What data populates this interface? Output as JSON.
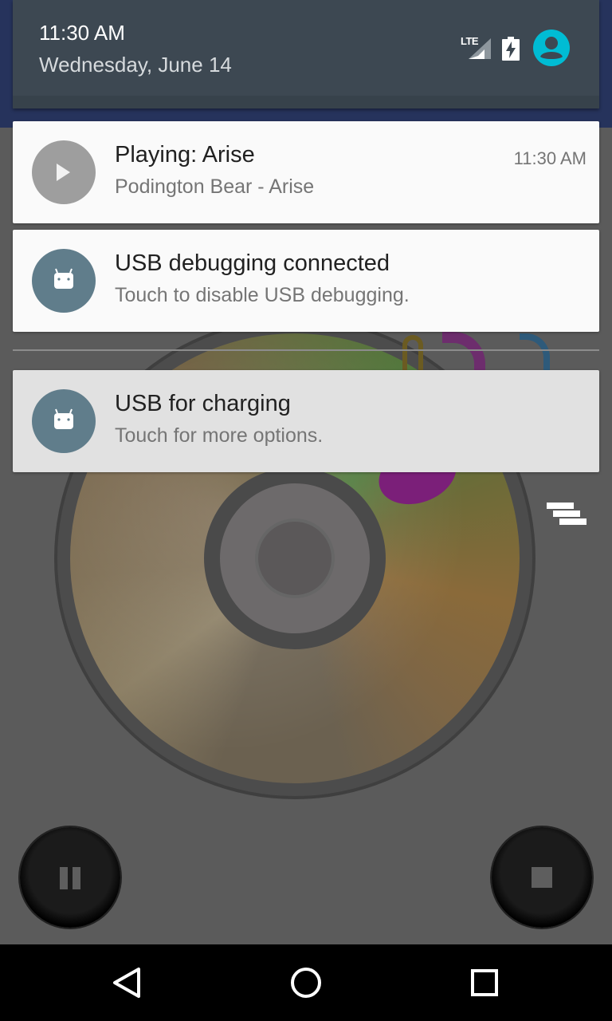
{
  "status": {
    "time": "11:30 AM",
    "date": "Wednesday, June 14",
    "network_label": "LTE",
    "icons": [
      "lte-signal-icon",
      "battery-charging-icon",
      "user-account-icon"
    ]
  },
  "notifications": [
    {
      "title": "Playing: Arise",
      "subtitle": "Podington Bear - Arise",
      "time": "11:30 AM",
      "icon": "play-icon",
      "icon_color": "#9e9e9e"
    },
    {
      "title": "USB debugging connected",
      "subtitle": "Touch to disable USB debugging.",
      "icon": "android-icon",
      "icon_color": "#607d8b"
    },
    {
      "title": "USB for charging",
      "subtitle": "Touch for more options.",
      "icon": "android-icon",
      "icon_color": "#607d8b"
    }
  ],
  "background_app": {
    "controls": [
      "pause-icon",
      "stop-icon",
      "overflow-menu-icon"
    ]
  },
  "navigation": [
    "back-icon",
    "home-icon",
    "recents-icon"
  ],
  "colors": {
    "shade_header": "#3d4852",
    "accent_avatar": "#00bcd4",
    "card": "#fafafa"
  }
}
